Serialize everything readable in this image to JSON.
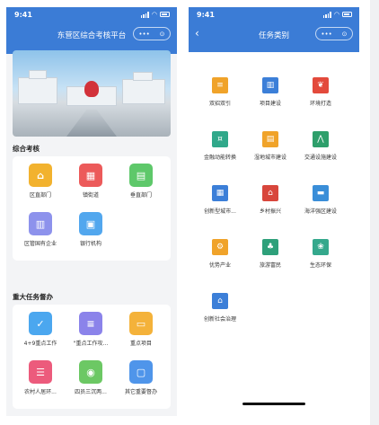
{
  "status": {
    "time": "9:41"
  },
  "left": {
    "title": "东营区综合考核平台",
    "sections": [
      {
        "title": "综合考核",
        "items": [
          {
            "label": "区直部门",
            "icon": "bank-icon",
            "color": "#f2b22e"
          },
          {
            "label": "镇街道",
            "icon": "map-icon",
            "color": "#ec5a5a"
          },
          {
            "label": "垂直部门",
            "icon": "building-icon",
            "color": "#5ec86a"
          },
          {
            "label": "区管国有企业",
            "icon": "enterprise-icon",
            "color": "#8d92ec"
          },
          {
            "label": "银行机构",
            "icon": "bank-building-icon",
            "color": "#52a7ee"
          }
        ]
      },
      {
        "title": "重大任务督办",
        "items": [
          {
            "label": "4+9重点工作",
            "icon": "checklist-icon",
            "color": "#4ba7ef"
          },
          {
            "label": "\"重点工作攻...",
            "icon": "document-icon",
            "color": "#8b83ea"
          },
          {
            "label": "重点项目",
            "icon": "folder-icon",
            "color": "#f4b23a"
          },
          {
            "label": "农村人居环...",
            "icon": "list-icon",
            "color": "#ec5b7c"
          },
          {
            "label": "四员三沉两...",
            "icon": "people-icon",
            "color": "#6cc864"
          },
          {
            "label": "其它重要督办",
            "icon": "clipboard-icon",
            "color": "#4f95ea"
          }
        ]
      }
    ]
  },
  "right": {
    "title": "任务类别",
    "categories": [
      {
        "label": "双招双引",
        "icon": "document-icon",
        "color": "#f0a32a"
      },
      {
        "label": "项目建设",
        "icon": "chart-icon",
        "color": "#3c7fd8"
      },
      {
        "label": "环境打造",
        "icon": "hand-leaf-icon",
        "color": "#e34a3c"
      },
      {
        "label": "金融动能转换",
        "icon": "money-icon",
        "color": "#30a88a"
      },
      {
        "label": "湿地城市建设",
        "icon": "city-icon",
        "color": "#f0a32a"
      },
      {
        "label": "交通设施建设",
        "icon": "road-icon",
        "color": "#2e9f6b"
      },
      {
        "label": "创新型城市...",
        "icon": "buildings-icon",
        "color": "#3c7fd8"
      },
      {
        "label": "乡村振兴",
        "icon": "village-icon",
        "color": "#d8463c"
      },
      {
        "label": "海洋强区建设",
        "icon": "ship-icon",
        "color": "#3a8ed8"
      },
      {
        "label": "优势产业",
        "icon": "industry-icon",
        "color": "#f0a32a"
      },
      {
        "label": "旅游富民",
        "icon": "palm-tree-icon",
        "color": "#2ea07a"
      },
      {
        "label": "生态环保",
        "icon": "eco-icon",
        "color": "#34a88c"
      },
      {
        "label": "创新社会治理",
        "icon": "community-icon",
        "color": "#3c7fd8"
      }
    ]
  }
}
